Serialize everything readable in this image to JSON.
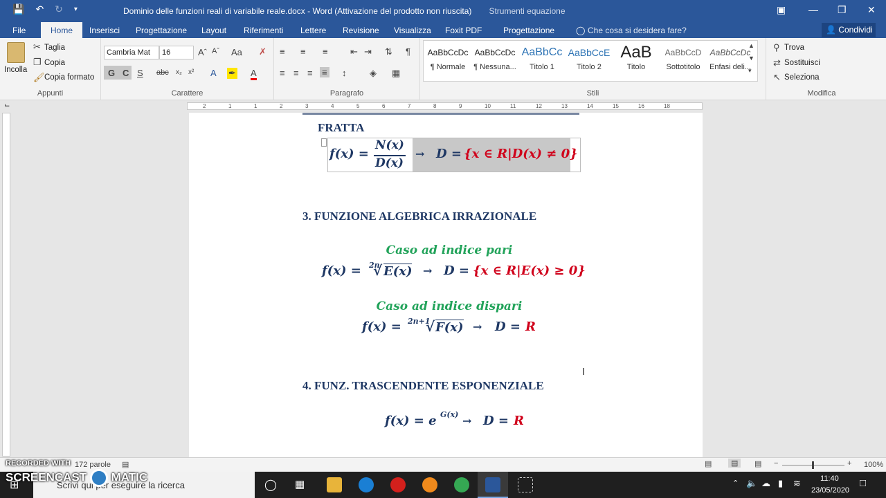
{
  "window": {
    "title": "Dominio delle funzioni reali di variabile reale.docx - Word (Attivazione del prodotto non riuscita)",
    "context_title": "Strumenti equazione"
  },
  "tabs": {
    "file": "File",
    "home": "Home",
    "insert": "Inserisci",
    "design": "Progettazione",
    "layout": "Layout",
    "references": "Riferimenti",
    "mailings": "Lettere",
    "review": "Revisione",
    "view": "Visualizza",
    "foxit": "Foxit PDF",
    "eq_design": "Progettazione",
    "tellme": "Che cosa si desidera fare?",
    "share": "Condividi"
  },
  "clipboard": {
    "paste": "Incolla",
    "cut": "Taglia",
    "copy": "Copia",
    "format_painter": "Copia formato",
    "label": "Appunti"
  },
  "font": {
    "family": "Cambria Mat",
    "size": "16",
    "label": "Carattere",
    "bold": "G",
    "italic": "C",
    "underline": "S",
    "strike": "abc"
  },
  "paragraph": {
    "label": "Paragrafo"
  },
  "styles": {
    "label": "Stili",
    "items": [
      {
        "preview": "AaBbCcDc",
        "name": "¶ Normale"
      },
      {
        "preview": "AaBbCcDc",
        "name": "¶ Nessuna..."
      },
      {
        "preview": "AaBbCc",
        "name": "Titolo 1"
      },
      {
        "preview": "AaBbCcE",
        "name": "Titolo 2"
      },
      {
        "preview": "AaB",
        "name": "Titolo"
      },
      {
        "preview": "AaBbCcD",
        "name": "Sottotitolo"
      },
      {
        "preview": "AaBbCcDc",
        "name": "Enfasi deli..."
      }
    ]
  },
  "editing": {
    "find": "Trova",
    "replace": "Sostituisci",
    "select": "Seleziona",
    "label": "Modifica"
  },
  "ruler": {
    "numbers": [
      "2",
      "1",
      "1",
      "2",
      "3",
      "4",
      "5",
      "6",
      "7",
      "8",
      "9",
      "10",
      "11",
      "12",
      "13",
      "14",
      "15",
      "16",
      "18"
    ]
  },
  "document": {
    "section2_heading_tail": "FRATTA",
    "eq_fratta_lhs": "f(x) =",
    "eq_fratta_num": "N(x)",
    "eq_fratta_den": "D(x)",
    "eq_fratta_arrow": "→",
    "eq_fratta_D": "D =",
    "eq_fratta_domain": "{x ∈ R|D(x) ≠ 0}",
    "section3_heading": "3. FUNZIONE ALGEBRICA IRRAZIONALE",
    "case_even": "Caso ad indice pari",
    "eq_even_lhs": "f(x) =",
    "eq_even_index": "2n",
    "eq_even_radicand": "E(x)",
    "eq_even_arrow": "→",
    "eq_even_D": "D =",
    "eq_even_domain": "{x ∈ R|E(x) ≥ 0}",
    "case_odd": "Caso ad indice dispari",
    "eq_odd_lhs": "f(x) =",
    "eq_odd_index": "2n+1",
    "eq_odd_radicand": "F(x)",
    "eq_odd_arrow": "→",
    "eq_odd_D": "D =",
    "eq_odd_domain": "R",
    "section4_heading": "4. FUNZ. TRASCENDENTE ESPONENZIALE",
    "eq_exp_lhs": "f(x) = e",
    "eq_exp_sup": "G(x)",
    "eq_exp_arrow": "→",
    "eq_exp_D": "D =",
    "eq_exp_domain": "R"
  },
  "statusbar": {
    "words": "172 parole",
    "zoom": "100%"
  },
  "taskbar": {
    "search_placeholder": "Scrivi qui per eseguire la ricerca",
    "time": "11:40",
    "date": "23/05/2020"
  },
  "watermark": {
    "line1": "RECORDED WITH",
    "line2": "SCREENCAST",
    "line3": "MATIC"
  }
}
